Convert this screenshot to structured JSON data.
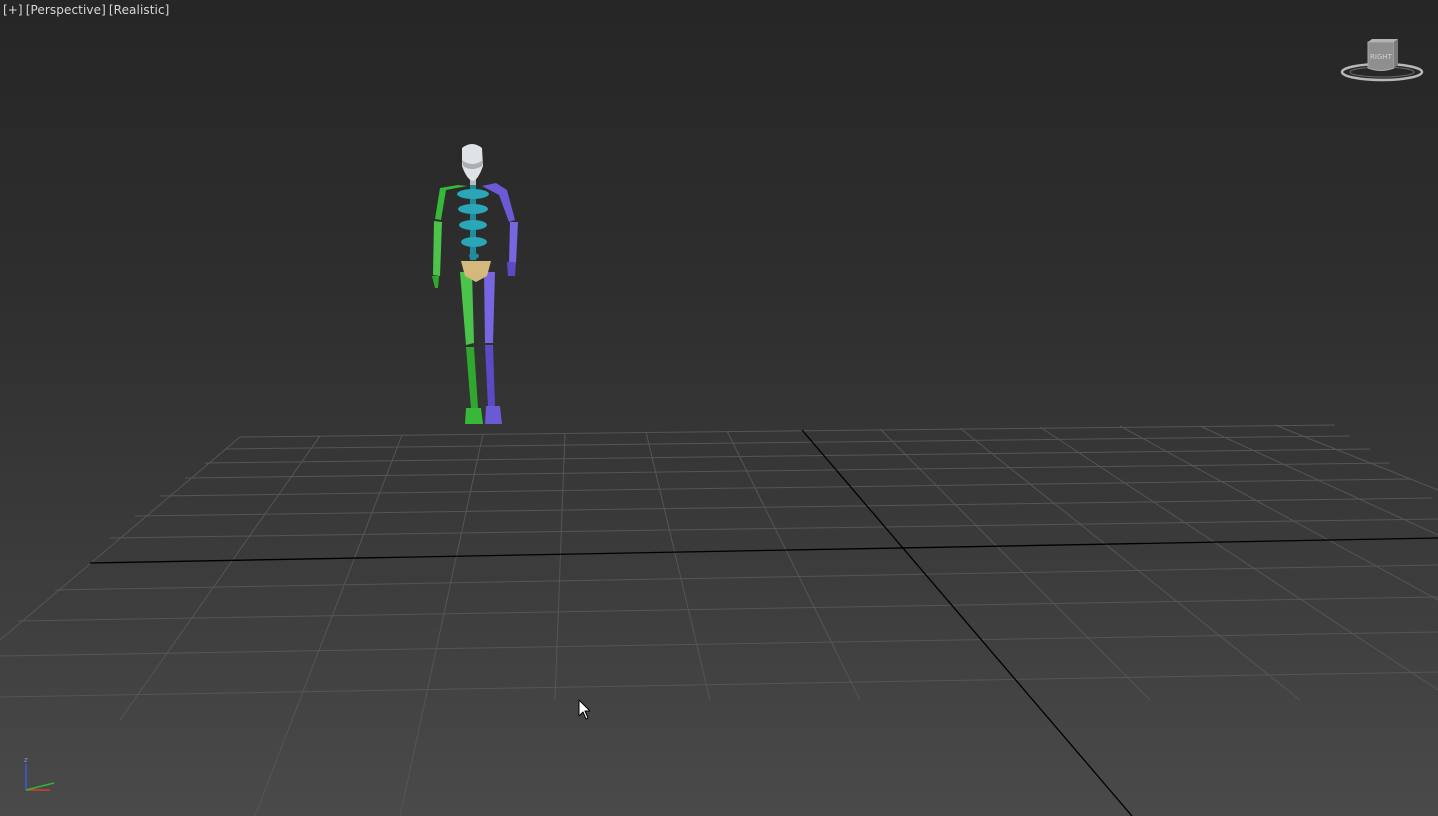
{
  "viewport": {
    "labels": {
      "plus": "[+]",
      "view": "[Perspective]",
      "shading": "[Realistic]"
    },
    "viewcube": {
      "face_label": "RIGHT"
    },
    "axis_tripod": {
      "z": "z",
      "x": "x",
      "y": "y"
    }
  },
  "colors": {
    "left_limbs": "#38b838",
    "right_limbs": "#6a5ad4",
    "spine": "#2aa6b8",
    "pelvis": "#d4b87c",
    "head": "#dfe3e6",
    "grid": "#555555",
    "axis_line": "#000000",
    "label_text": "#d8d8d8"
  },
  "icons": {
    "cursor": "arrow-cursor-icon",
    "viewcube": "viewcube-icon",
    "tripod": "axis-tripod-icon"
  }
}
